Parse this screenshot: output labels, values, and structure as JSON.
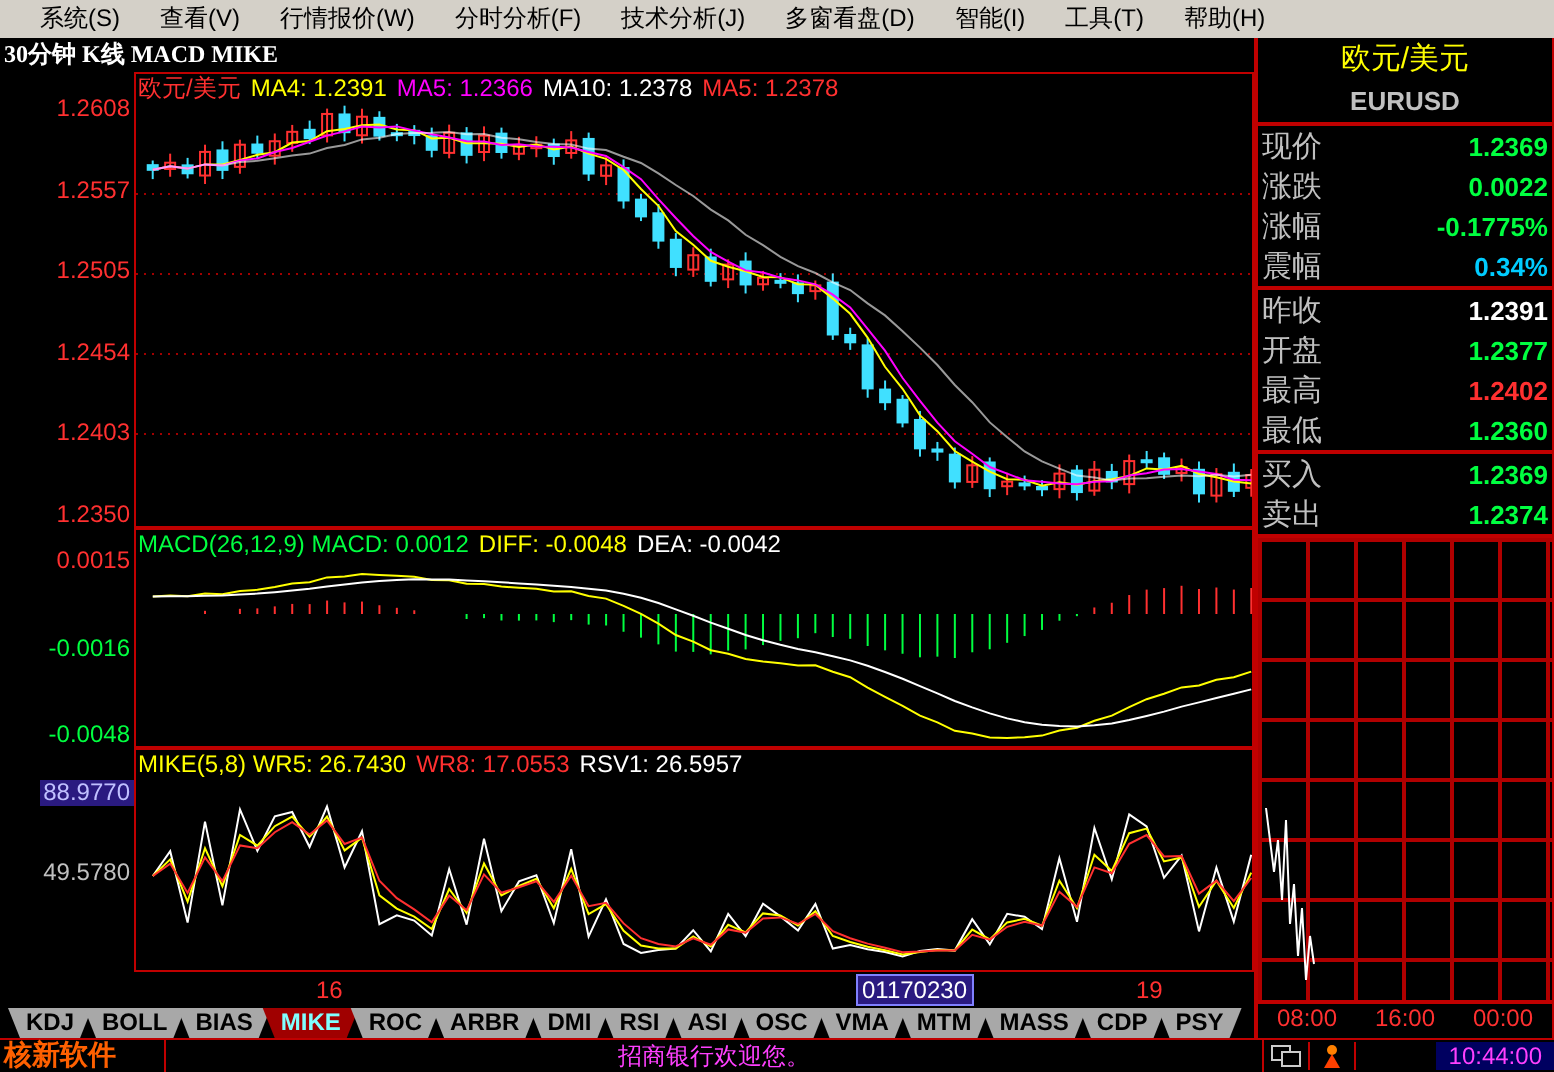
{
  "menu": [
    {
      "label": "系统(S)"
    },
    {
      "label": "查看(V)"
    },
    {
      "label": "行情报价(W)"
    },
    {
      "label": "分时分析(F)"
    },
    {
      "label": "技术分析(J)"
    },
    {
      "label": "多窗看盘(D)"
    },
    {
      "label": "智能(I)"
    },
    {
      "label": "工具(T)"
    },
    {
      "label": "帮助(H)"
    }
  ],
  "chart_title": "30分钟 K线 MACD MIKE",
  "price_panel": {
    "legend": [
      {
        "label": "欧元/美元",
        "color": "#ff3030"
      },
      {
        "label": "MA4: 1.2391",
        "color": "#ffff00"
      },
      {
        "label": "MA5: 1.2366",
        "color": "#ff00ff"
      },
      {
        "label": "MA10: 1.2378",
        "color": "#ffffff"
      },
      {
        "label": "MA5: 1.2378",
        "color": "#ff3030"
      }
    ],
    "y_labels": [
      "1.2608",
      "1.2557",
      "1.2505",
      "1.2454",
      "1.2403",
      "1.2350"
    ]
  },
  "macd_panel": {
    "legend": [
      {
        "label": "MACD(26,12,9) MACD: 0.0012",
        "color": "#00ff40"
      },
      {
        "label": "DIFF: -0.0048",
        "color": "#ffff00"
      },
      {
        "label": "DEA: -0.0042",
        "color": "#ffffff"
      }
    ],
    "y_labels": [
      {
        "text": "0.0015",
        "color": "#ff3030"
      },
      {
        "text": "-0.0016",
        "color": "#00ff40"
      },
      {
        "text": "-0.0048",
        "color": "#00ff40"
      }
    ]
  },
  "mike_panel": {
    "legend": [
      {
        "label": "MIKE(5,8) WR5: 26.7430",
        "color": "#ffff00"
      },
      {
        "label": "WR8: 17.0553",
        "color": "#ff3030"
      },
      {
        "label": "RSV1: 26.5957",
        "color": "#ffffff"
      }
    ],
    "y_labels": [
      {
        "text": "88.9770",
        "selected": true
      },
      {
        "text": "49.5780",
        "selected": false
      }
    ]
  },
  "x_axis": [
    {
      "label": "16",
      "selected": false
    },
    {
      "label": "01170230",
      "selected": true
    },
    {
      "label": "19",
      "selected": false
    }
  ],
  "indicator_tabs": [
    {
      "label": "KDJ",
      "selected": false
    },
    {
      "label": "BOLL",
      "selected": false
    },
    {
      "label": "BIAS",
      "selected": false
    },
    {
      "label": "MIKE",
      "selected": true
    },
    {
      "label": "ROC",
      "selected": false
    },
    {
      "label": "ARBR",
      "selected": false
    },
    {
      "label": "DMI",
      "selected": false
    },
    {
      "label": "RSI",
      "selected": false
    },
    {
      "label": "ASI",
      "selected": false
    },
    {
      "label": "OSC",
      "selected": false
    },
    {
      "label": "VMA",
      "selected": false
    },
    {
      "label": "MTM",
      "selected": false
    },
    {
      "label": "MASS",
      "selected": false
    },
    {
      "label": "CDP",
      "selected": false
    },
    {
      "label": "PSY",
      "selected": false
    }
  ],
  "quote": {
    "name": "欧元/美元",
    "code": "EURUSD",
    "groups": [
      [
        {
          "label": "现价",
          "value": "1.2369",
          "color": "#00ff40"
        },
        {
          "label": "涨跌",
          "value": "0.0022",
          "color": "#00ff40"
        },
        {
          "label": "涨幅",
          "value": "-0.1775%",
          "color": "#00ff40"
        },
        {
          "label": "震幅",
          "value": "0.34%",
          "color": "#00ccff"
        }
      ],
      [
        {
          "label": "昨收",
          "value": "1.2391",
          "color": "#ffffff"
        },
        {
          "label": "开盘",
          "value": "1.2377",
          "color": "#00ff40"
        },
        {
          "label": "最高",
          "value": "1.2402",
          "color": "#ff3030"
        },
        {
          "label": "最低",
          "value": "1.2360",
          "color": "#00ff40"
        }
      ],
      [
        {
          "label": "买入",
          "value": "1.2369",
          "color": "#00ff40"
        },
        {
          "label": "卖出",
          "value": "1.2374",
          "color": "#00ff40"
        }
      ]
    ]
  },
  "time_axis": [
    "08:00",
    "16:00",
    "00:00"
  ],
  "status_bar": {
    "brand": "核新软件",
    "message": "招商银行欢迎您。",
    "time": "10:44:00"
  }
}
